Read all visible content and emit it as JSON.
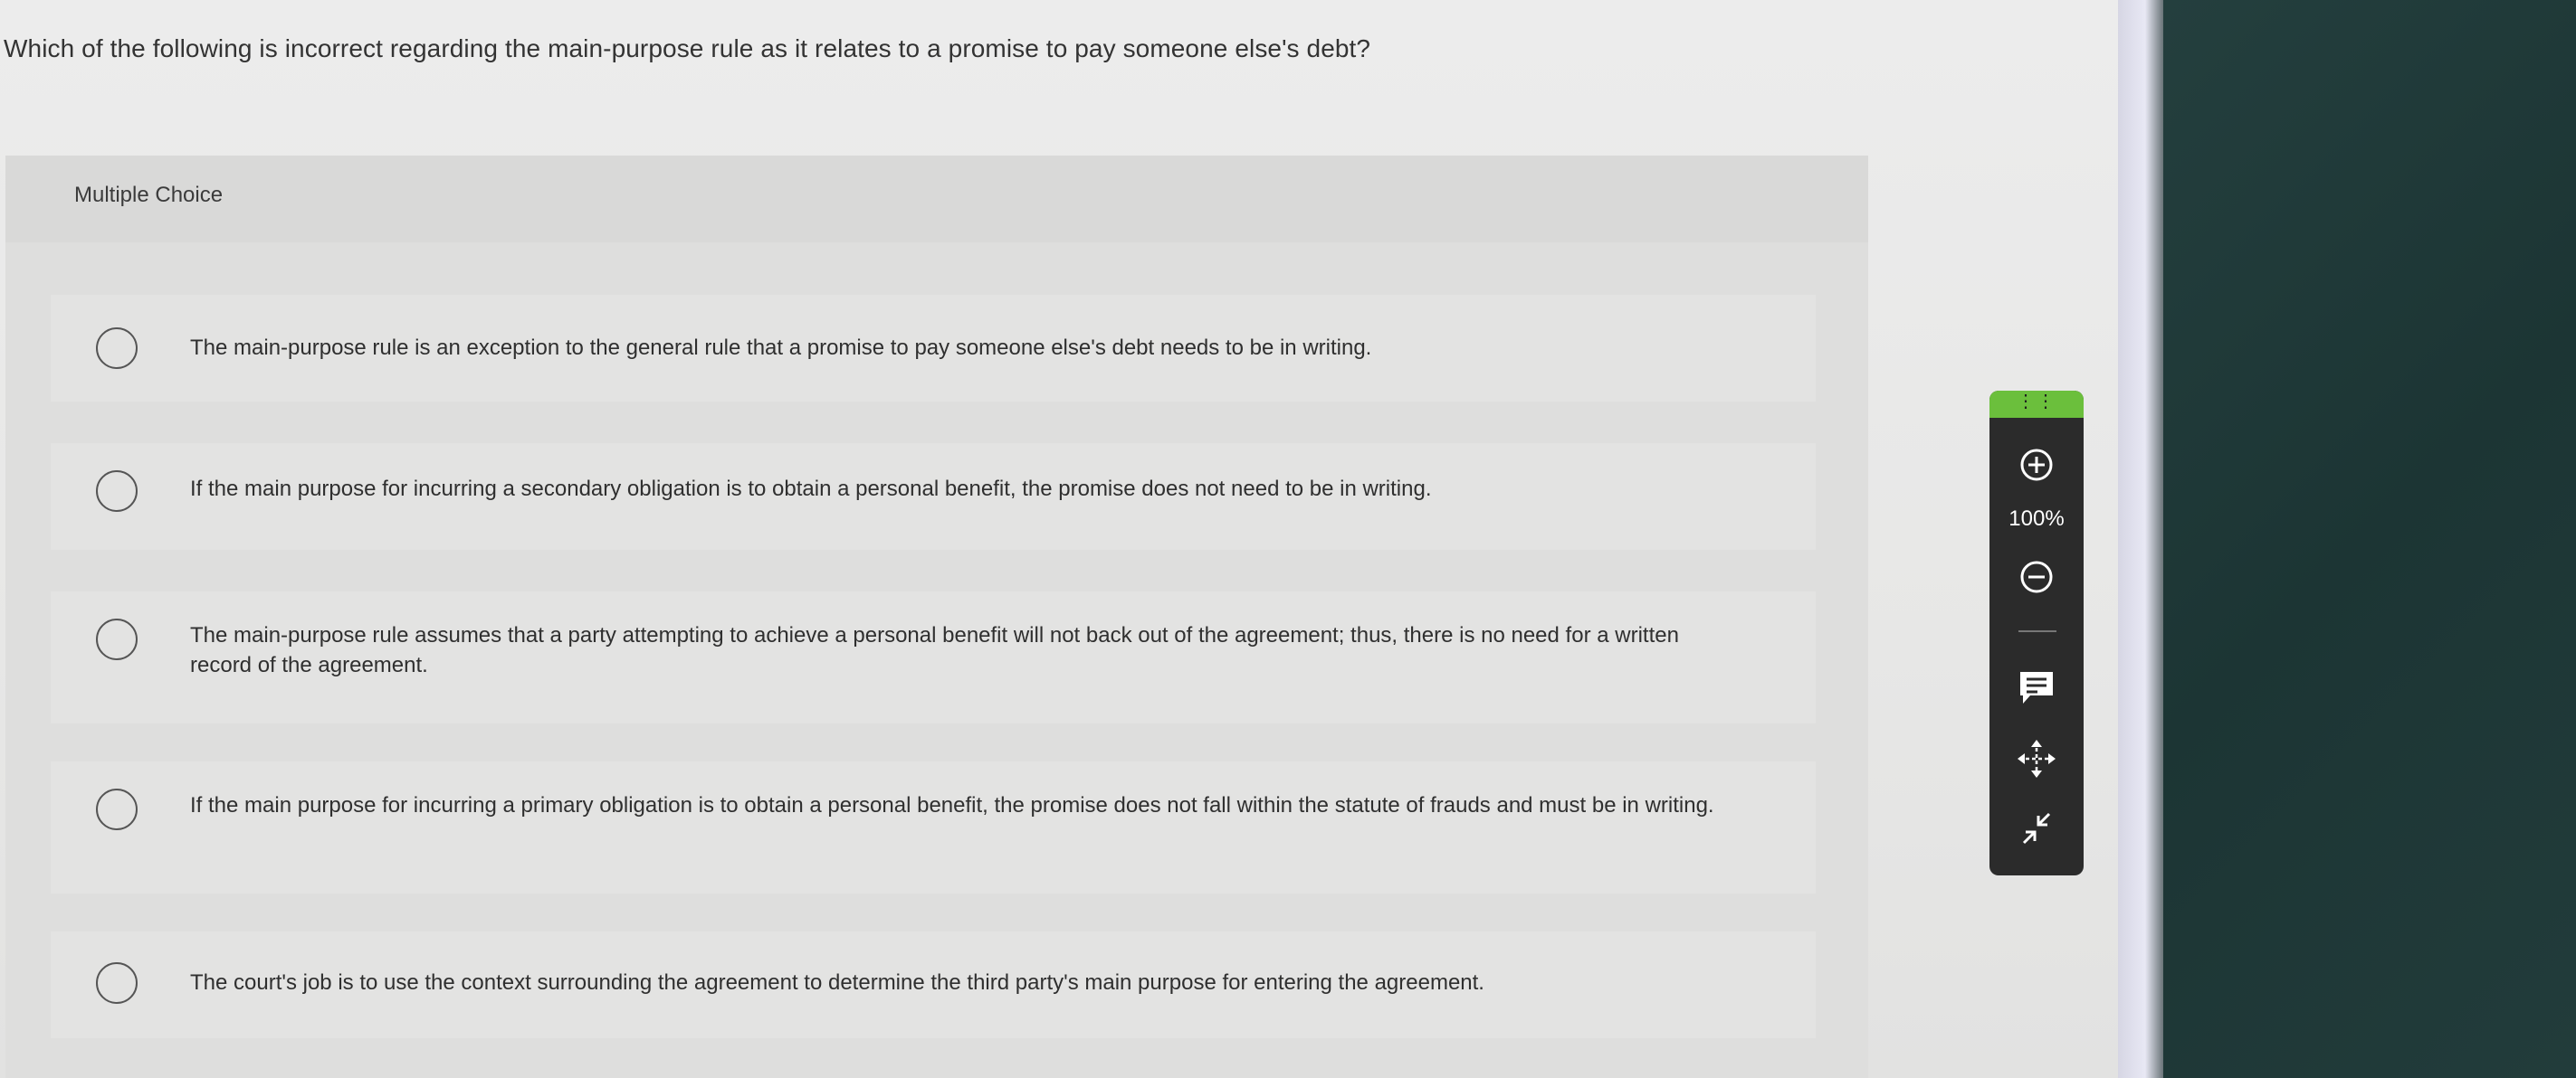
{
  "question": "Which of the following is incorrect regarding the main-purpose rule as it relates to a promise to pay someone else's debt?",
  "section_label": "Multiple Choice",
  "options": [
    {
      "text": "The main-purpose rule is an exception to the general rule that a promise to pay someone else's debt needs to be in writing."
    },
    {
      "text": "If the main purpose for incurring a secondary obligation is to obtain a personal benefit, the promise does not need to be in writing."
    },
    {
      "text": "The main-purpose rule assumes that a party attempting to achieve a personal benefit will not back out of the agreement; thus, there is no need for a written record of the agreement."
    },
    {
      "text": "If the main purpose for incurring a primary obligation is to obtain a personal benefit, the promise does not fall within the statute of frauds and must be in writing."
    },
    {
      "text": "The court's job is to use the context surrounding the agreement to determine the third party's main purpose for entering the agreement."
    }
  ],
  "toolbar": {
    "zoom_level": "100%",
    "grip_glyph": "⋮⋮",
    "icons": [
      "drag-grip-icon",
      "zoom-in-icon",
      "zoom-out-icon",
      "comment-icon",
      "move-icon",
      "collapse-icon"
    ],
    "grip_color": "#6bbf3c"
  }
}
